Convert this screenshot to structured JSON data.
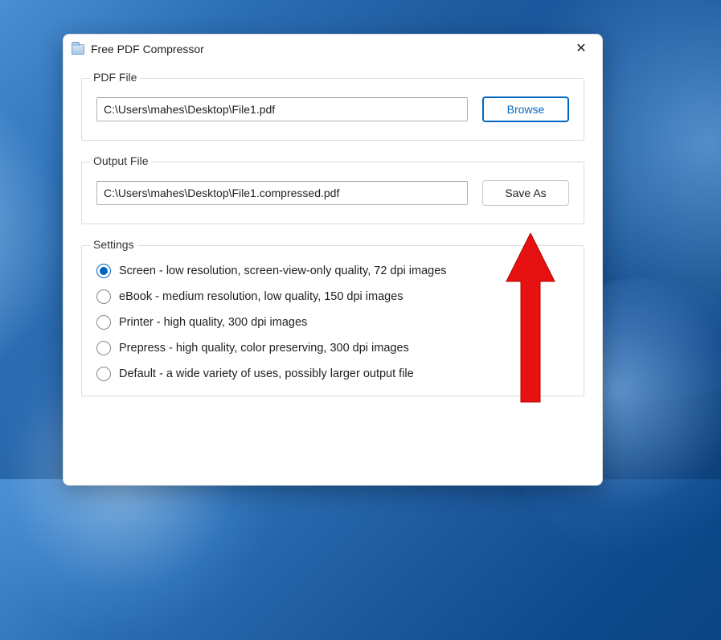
{
  "window": {
    "title": "Free PDF Compressor"
  },
  "pdf_file": {
    "group_label": "PDF File",
    "value": "C:\\Users\\mahes\\Desktop\\File1.pdf",
    "browse_label": "Browse"
  },
  "output_file": {
    "group_label": "Output File",
    "value": "C:\\Users\\mahes\\Desktop\\File1.compressed.pdf",
    "save_as_label": "Save As"
  },
  "settings": {
    "group_label": "Settings",
    "selected_index": 0,
    "options": [
      {
        "label": "Screen - low resolution, screen-view-only quality, 72 dpi images"
      },
      {
        "label": "eBook - medium resolution, low quality, 150 dpi images"
      },
      {
        "label": "Printer - high quality, 300 dpi images"
      },
      {
        "label": "Prepress - high quality, color preserving, 300 dpi images"
      },
      {
        "label": "Default - a wide variety of uses, possibly larger output file"
      }
    ]
  },
  "colors": {
    "accent": "#0067c0",
    "arrow": "#e61212"
  }
}
